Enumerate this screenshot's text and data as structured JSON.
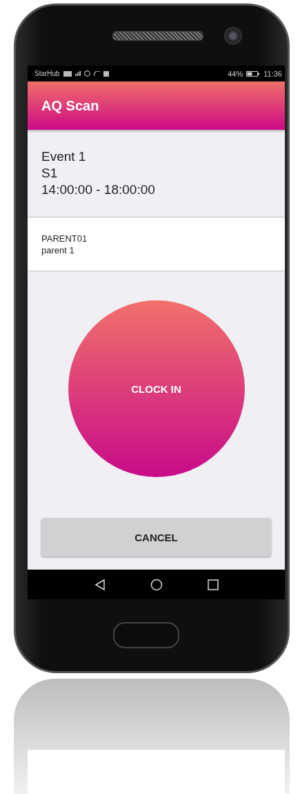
{
  "status_bar": {
    "carrier": "StarHub",
    "battery": "44%",
    "time": "11:36"
  },
  "app_bar": {
    "title": "AQ Scan"
  },
  "event": {
    "name": "Event 1",
    "session": "S1",
    "time_range": "14:00:00 - 18:00:00"
  },
  "parent": {
    "code": "PARENT01",
    "name": "parent 1"
  },
  "clock_in_button": "CLOCK IN",
  "cancel_button": "CANCEL"
}
